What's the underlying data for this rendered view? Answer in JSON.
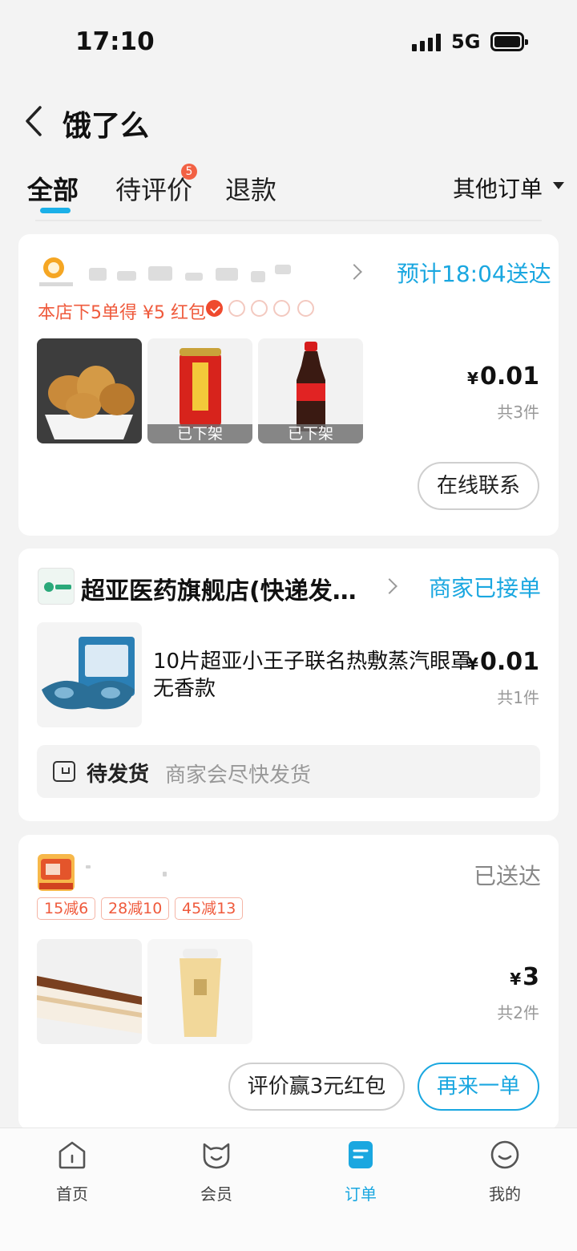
{
  "status_bar": {
    "time": "17:10",
    "network": "5G"
  },
  "header": {
    "title": "饿了么"
  },
  "tabs": [
    {
      "label": "全部",
      "active": true
    },
    {
      "label": "待评价",
      "badge": "5"
    },
    {
      "label": "退款"
    }
  ],
  "other_orders": "其他订单",
  "orders": [
    {
      "status": "预计18:04送达",
      "promo": "本店下5单得 ¥5 红包",
      "items": [
        {
          "icon": "fried-chicken-image"
        },
        {
          "icon": "herbal-tea-can-image",
          "note": "已下架"
        },
        {
          "icon": "cola-bottle-image",
          "note": "已下架"
        }
      ],
      "currency": "¥",
      "price": "0.01",
      "count": "共3件",
      "action": "在线联系"
    },
    {
      "store": "超亚医药旗舰店(快递发…",
      "status": "商家已接单",
      "product": "10片超亚小王子联名热敷蒸汽眼罩无香款",
      "currency": "¥",
      "price": "0.01",
      "count": "共1件",
      "shipping_title": "待发货",
      "shipping_desc": "商家会尽快发货"
    },
    {
      "status": "已送达",
      "coupons": [
        "15减6",
        "28减10",
        "45减13"
      ],
      "currency": "¥",
      "price": "3",
      "count": "共2件",
      "review_action": "评价赢3元红包",
      "reorder_action": "再来一单"
    }
  ],
  "nav": [
    {
      "label": "首页",
      "icon": "home-icon"
    },
    {
      "label": "会员",
      "icon": "member-icon"
    },
    {
      "label": "订单",
      "icon": "orders-icon",
      "active": true
    },
    {
      "label": "我的",
      "icon": "profile-icon"
    }
  ],
  "colors": {
    "accent": "#1aa7e0",
    "promo": "#ef5a3c",
    "badge": "#f26144"
  }
}
